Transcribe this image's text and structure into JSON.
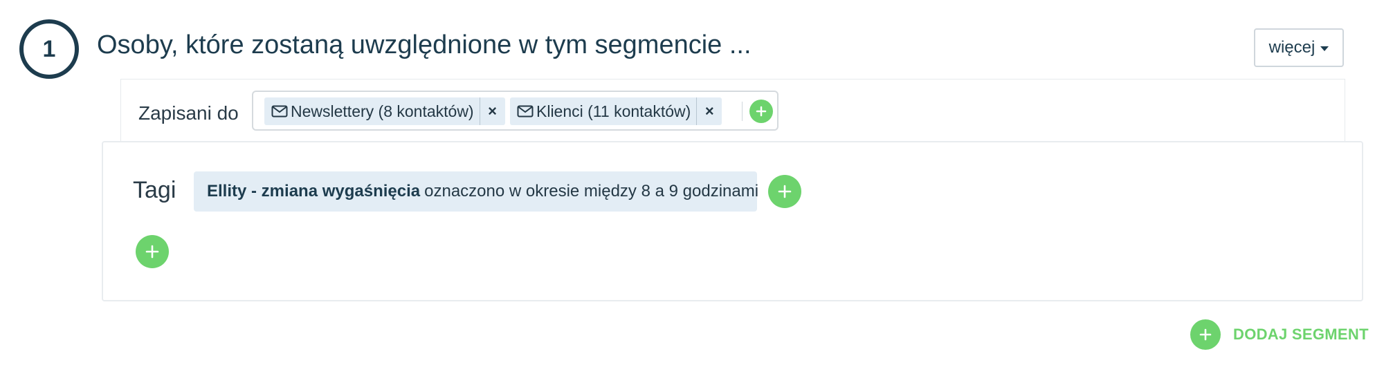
{
  "segment": {
    "number": "1",
    "title": "Osoby, które zostaną uwzględnione w tym segmencie ...",
    "more_button": "więcej"
  },
  "subscribed": {
    "label": "Zapisani do",
    "lists": [
      {
        "icon": "envelope-icon",
        "label": "Newslettery (8 kontaktów)",
        "remove": "×"
      },
      {
        "icon": "envelope-icon",
        "label": "Klienci (11 kontaktów)",
        "remove": "×"
      }
    ]
  },
  "tags": {
    "label": "Tagi",
    "condition": {
      "tag_name": "Ellity - zmiana wygaśnięcia",
      "description": "oznaczono w okresie między 8 a 9 godzinami"
    }
  },
  "actions": {
    "add_segment": "DODAJ SEGMENT"
  },
  "colors": {
    "primary_text": "#1d3c4e",
    "accent_green": "#6dd36d",
    "chip_background": "#e3edf5",
    "border": "#e8ecef"
  }
}
